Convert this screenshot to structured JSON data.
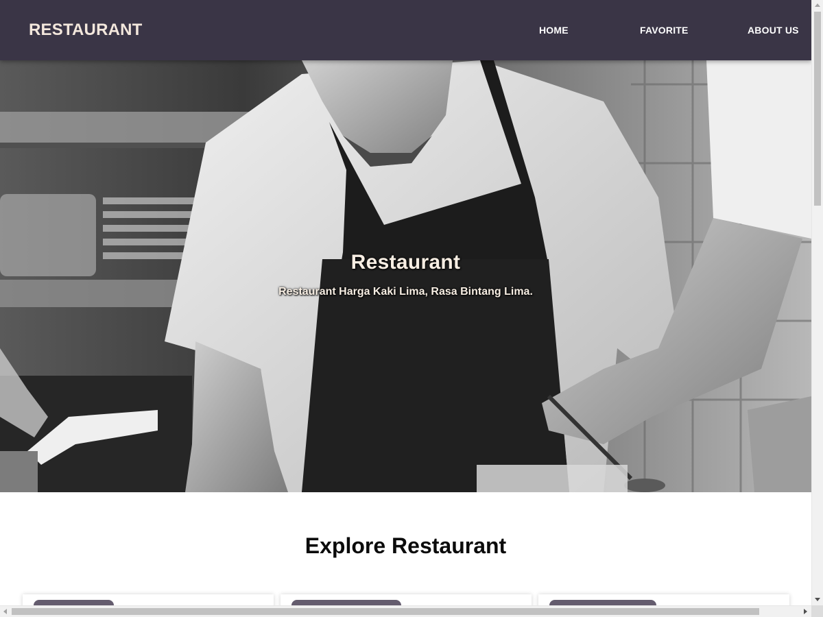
{
  "header": {
    "brand": "RESTAURANT",
    "nav": [
      {
        "label": "HOME"
      },
      {
        "label": "FAVORITE"
      },
      {
        "label": "ABOUT US"
      }
    ],
    "background_color": "#3a3546",
    "brand_color": "#f3e7dc"
  },
  "hero": {
    "image_subject": "black-and-white photo of a chef plating food in a kitchen",
    "title": "Restaurant",
    "tagline": "Restaurant Harga Kaki Lima, Rasa Bintang Lima."
  },
  "explore": {
    "title": "Explore Restaurant",
    "cards": [
      {
        "badge": ""
      },
      {
        "badge": ""
      },
      {
        "badge": ""
      }
    ],
    "badge_color": "#645c6e"
  }
}
